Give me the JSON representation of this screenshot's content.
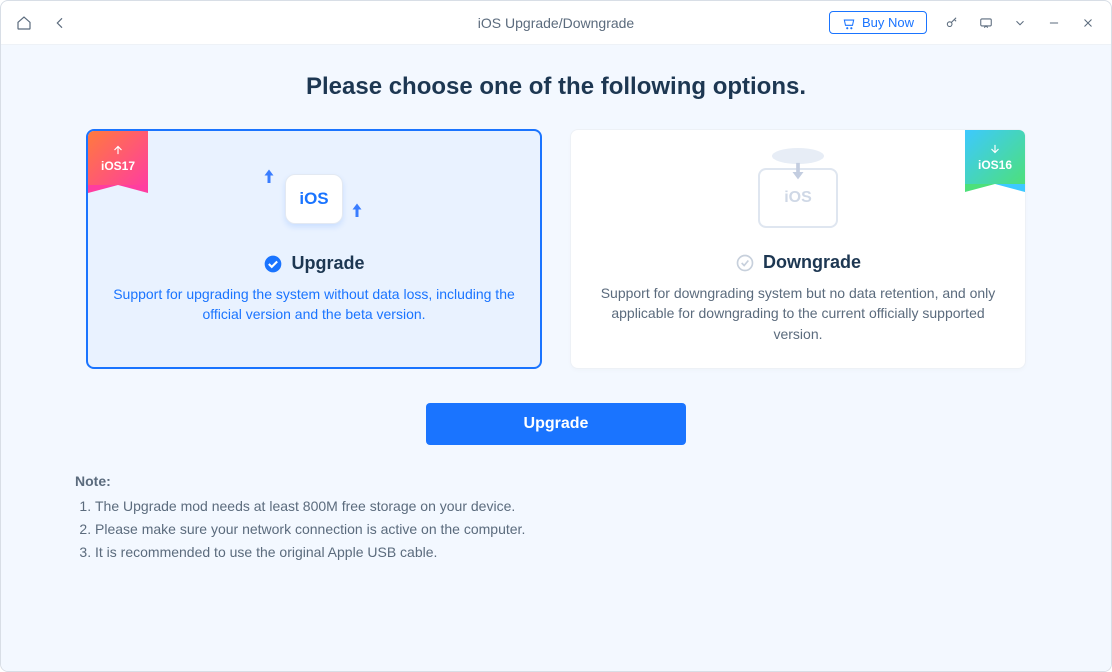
{
  "titlebar": {
    "title": "iOS Upgrade/Downgrade",
    "buy_now": "Buy Now"
  },
  "main": {
    "heading": "Please choose one of the following options.",
    "cards": {
      "upgrade": {
        "ribbon": "iOS17",
        "badge_text": "iOS",
        "title": "Upgrade",
        "desc": "Support for upgrading the system without data loss, including the official version and the beta version."
      },
      "downgrade": {
        "ribbon": "iOS16",
        "badge_text": "iOS",
        "title": "Downgrade",
        "desc": "Support for downgrading system but no data retention, and only applicable for downgrading to the current officially supported version."
      }
    },
    "primary_button": "Upgrade"
  },
  "notes": {
    "title": "Note:",
    "items": [
      "The Upgrade mod needs at least 800M free storage on your device.",
      "Please make sure your network connection is active on the computer.",
      "It is recommended to use the original Apple USB cable."
    ]
  }
}
